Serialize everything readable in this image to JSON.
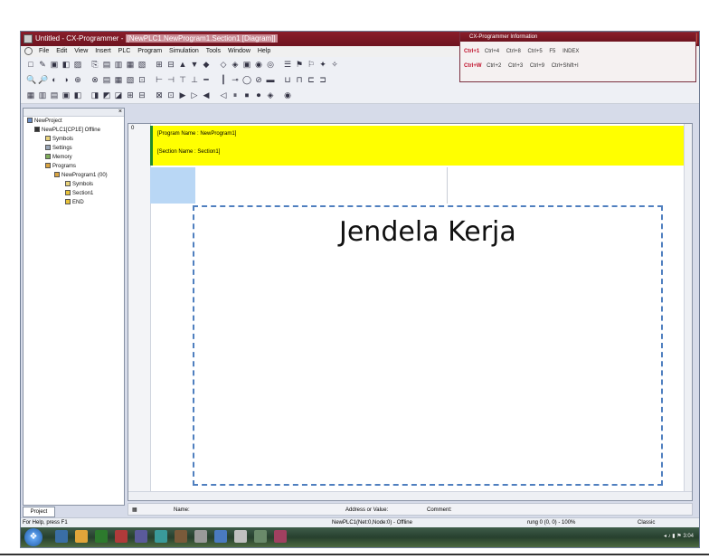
{
  "window": {
    "title_prefix": "Untitled - CX-Programmer - ",
    "title_highlight": "[NewPLC1.NewProgram1.Section1 [Diagram]]",
    "close_glyph": "✕"
  },
  "menu": [
    "File",
    "Edit",
    "View",
    "Insert",
    "PLC",
    "Program",
    "Simulation",
    "Tools",
    "Window",
    "Help"
  ],
  "toolbar_icons": {
    "row1": [
      "□",
      "✎",
      "▣",
      "◧",
      "▨",
      "⎘",
      "▤",
      "▥",
      "▦",
      "▧",
      "⊞",
      "⊟",
      "▲",
      "▼",
      "◆",
      "◇",
      "◈",
      "▣",
      "◉",
      "◎",
      "☰",
      "⚑",
      "⚐",
      "✦",
      "✧"
    ],
    "row2": [
      "🔍",
      "🔎",
      "◐",
      "◑",
      "⊕",
      "⊗",
      "▤",
      "▦",
      "▧",
      "⊡",
      "⊢",
      "⊣",
      "⊤",
      "⊥",
      "━",
      "┃",
      "⊸",
      "◯",
      "⊘",
      "▬",
      "⊔",
      "⊓",
      "⊏",
      "⊐"
    ],
    "row3": [
      "▦",
      "▥",
      "▤",
      "▣",
      "◧",
      "◨",
      "◩",
      "◪",
      "⊞",
      "⊟",
      "⊠",
      "⊡",
      "▶",
      "▷",
      "◀",
      "◁",
      "⏸",
      "⏹",
      "⏺",
      "◈",
      "◉"
    ]
  },
  "info_window": {
    "title": "CX-Programmer Information",
    "row1_hotkey": "Ctrl+1",
    "row1_cells": [
      "Ctrl+4",
      "Ctrl+8",
      "Ctrl+5",
      "F5",
      "INDEX"
    ],
    "row2_hotkey": "Ctrl+W",
    "row2_cells": [
      "Ctrl+2",
      "Ctrl+3",
      "Ctrl+9",
      "Ctrl+Shift+I"
    ]
  },
  "tree": {
    "tab_label": "Project",
    "items": [
      {
        "label": "NewProject",
        "indent": 0
      },
      {
        "label": "NewPLC1[CP1E] Offline",
        "indent": 1
      },
      {
        "label": "Symbols",
        "indent": 2
      },
      {
        "label": "Settings",
        "indent": 2
      },
      {
        "label": "Memory",
        "indent": 2
      },
      {
        "label": "Programs",
        "indent": 2
      },
      {
        "label": "NewProgram1 (00)",
        "indent": 3
      },
      {
        "label": "Symbols",
        "indent": 4
      },
      {
        "label": "Section1",
        "indent": 4
      },
      {
        "label": "END",
        "indent": 4
      }
    ]
  },
  "ladder": {
    "rung_number": "0",
    "program_name": "[Program Name : NewProgram1]",
    "section_name": "[Section Name : Section1]"
  },
  "workarea_label": "Jendela Kerja",
  "grid_headers": {
    "name": "Name:",
    "address": "Address or Value:",
    "comment": "Comment:"
  },
  "status": {
    "help": "For Help, press F1",
    "plc": "NewPLC1(Net:0,Node:0) - Offline",
    "rung": "rung 0 (0, 0) - 100%",
    "mode": "Classic"
  },
  "tray_text": "◂ ♪ ▮ ⚑  3:04",
  "colors": {
    "yellow_bar": "#ffff00",
    "green_rail": "#1f8a2a",
    "dash": "#4f7fbf",
    "title": "#8a1d2a"
  }
}
